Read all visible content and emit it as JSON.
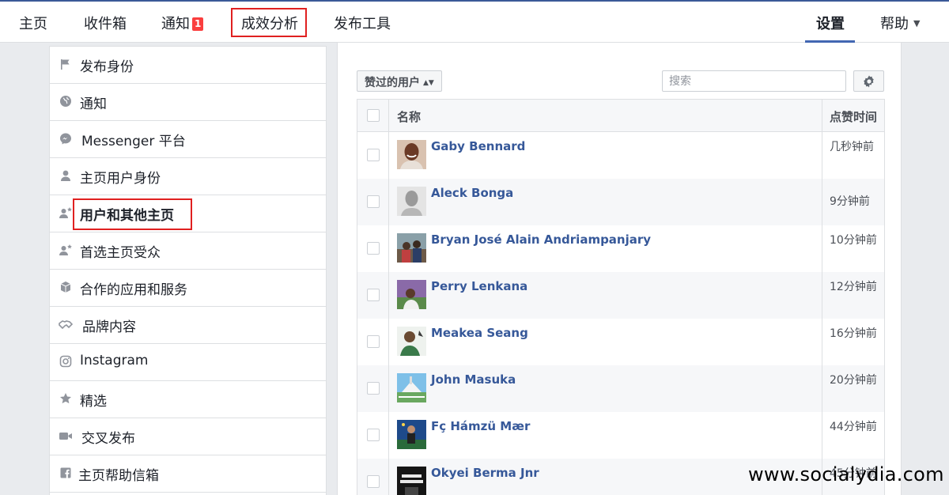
{
  "nav": {
    "home": "主页",
    "inbox": "收件箱",
    "notifications": "通知",
    "notification_count": "1",
    "insights": "成效分析",
    "publishing_tools": "发布工具",
    "settings": "设置",
    "help": "帮助"
  },
  "sidebar": {
    "items": [
      {
        "label": "发布身份",
        "icon": "flag-icon"
      },
      {
        "label": "通知",
        "icon": "globe-icon"
      },
      {
        "label": "Messenger 平台",
        "icon": "messenger-icon"
      },
      {
        "label": "主页用户身份",
        "icon": "person-icon"
      },
      {
        "label": "用户和其他主页",
        "icon": "person-star-icon",
        "active": true
      },
      {
        "label": "首选主页受众",
        "icon": "person-star-icon"
      },
      {
        "label": "合作的应用和服务",
        "icon": "cube-icon"
      },
      {
        "label": "品牌内容",
        "icon": "handshake-icon"
      },
      {
        "label": "Instagram",
        "icon": "instagram-icon"
      },
      {
        "label": "精选",
        "icon": "star-icon"
      },
      {
        "label": "交叉发布",
        "icon": "video-camera-icon"
      },
      {
        "label": "主页帮助信箱",
        "icon": "facebook-icon"
      }
    ]
  },
  "toolbar": {
    "filter_label": "赞过的用户",
    "search_placeholder": "搜索"
  },
  "table": {
    "columns": {
      "name": "名称",
      "time": "点赞时间"
    },
    "rows": [
      {
        "name": "Gaby Bennard",
        "time": "几秒钟前"
      },
      {
        "name": "Aleck Bonga",
        "time": "9分钟前"
      },
      {
        "name": "Bryan José Alain Andriampanjary",
        "time": "10分钟前"
      },
      {
        "name": "Perry Lenkana",
        "time": "12分钟前"
      },
      {
        "name": "Meakea Seang",
        "time": "16分钟前"
      },
      {
        "name": "John Masuka",
        "time": "20分钟前"
      },
      {
        "name": "Fç Hámzü Mær",
        "time": "44分钟前"
      },
      {
        "name": "Okyei Berma Jnr",
        "time": "45分钟前"
      }
    ]
  },
  "watermark": "www.socialydia.com",
  "colors": {
    "link": "#365899",
    "highlight": "#e02020",
    "badge": "#fa3e3e",
    "accent": "#4267b2"
  }
}
